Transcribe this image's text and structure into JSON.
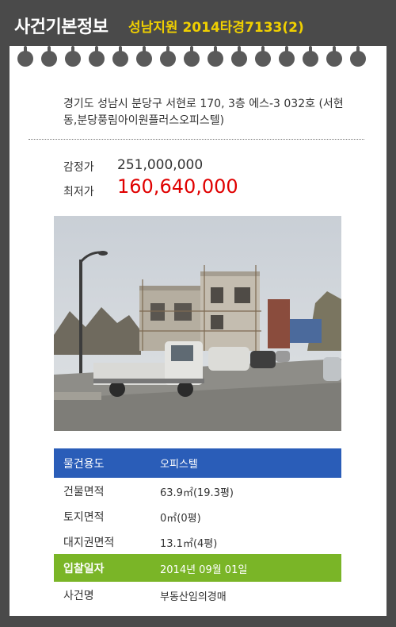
{
  "header": {
    "title": "사건기본정보",
    "case_info": "성남지원 2014타경7133(2)"
  },
  "address": "경기도 성남시 분당구 서현로 170, 3층 에스-3 032호 (서현동,분당풍림아이원플러스오피스텔)",
  "prices": {
    "appraisal_label": "감정가",
    "appraisal_value": "251,000,000",
    "minimum_label": "최저가",
    "minimum_value": "160,640,000"
  },
  "details": [
    {
      "label": "물건용도",
      "value": "오피스텔"
    },
    {
      "label": "건물면적",
      "value": "63.9㎡(19.3평)"
    },
    {
      "label": "토지면적",
      "value": "0㎡(0평)"
    },
    {
      "label": "대지권면적",
      "value": "13.1㎡(4평)"
    },
    {
      "label": "입찰일자",
      "value": "2014년 09월 01일"
    },
    {
      "label": "사건명",
      "value": "부동산임의경매"
    }
  ],
  "colors": {
    "background": "#4a4a4a",
    "case_text": "#f0d000",
    "min_price": "#e00000",
    "usage_row": "#2a5db8",
    "bid_date_row": "#7ab527"
  }
}
